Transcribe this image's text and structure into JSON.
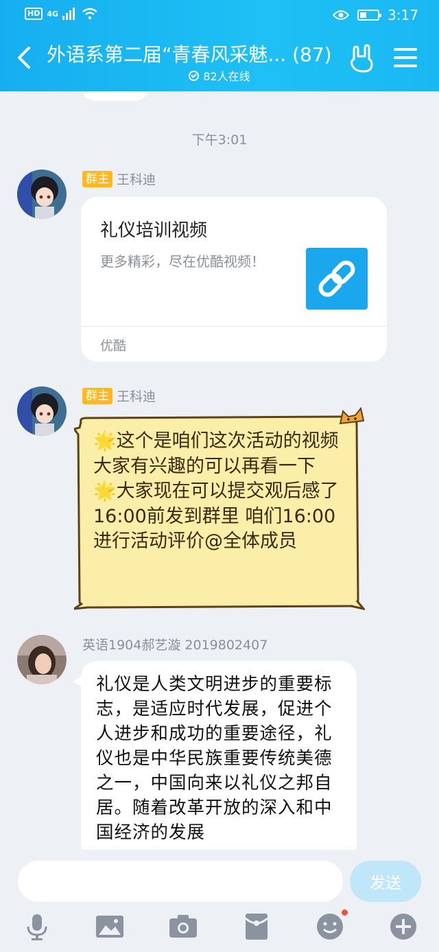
{
  "status_bar": {
    "hd": "HD",
    "network": "4G",
    "time": "3:17"
  },
  "header": {
    "title": "外语系第二届“青春风采魅...",
    "member_count": "(87)",
    "online": "82人在线"
  },
  "chat": {
    "timestamp": "下午3:01",
    "messages": [
      {
        "badge": "群主",
        "sender": "王科迪",
        "card": {
          "title": "礼仪培训视频",
          "description": "更多精彩，尽在优酷视频！",
          "source": "优酷"
        }
      },
      {
        "badge": "群主",
        "sender": "王科迪",
        "text": "🌟这个是咱们这次活动的视频 大家有兴趣的可以再看一下\n🌟大家现在可以提交观后感了 16:00前发到群里 咱们16:00进行活动评价@全体成员"
      },
      {
        "sender": "英语1904郝艺漩 2019802407",
        "text": "礼仪是人类文明进步的重要标志，是适应时代发展，促进个人进步和成功的重要途径，礼仪也是中华民族重要传统美德之一，中国向来以礼仪之邦自居。随着改革开放的深入和中国经济的发展"
      }
    ]
  },
  "input": {
    "placeholder": "",
    "send_label": "发送"
  },
  "colors": {
    "header_blue": "#16aef0",
    "badge_orange": "#ffb820",
    "link_blue": "#1aa7ee"
  },
  "icons": [
    "back-icon",
    "hand-icon",
    "menu-icon",
    "mic-icon",
    "image-icon",
    "camera-icon",
    "red-packet-icon",
    "emoji-icon",
    "plus-icon"
  ]
}
